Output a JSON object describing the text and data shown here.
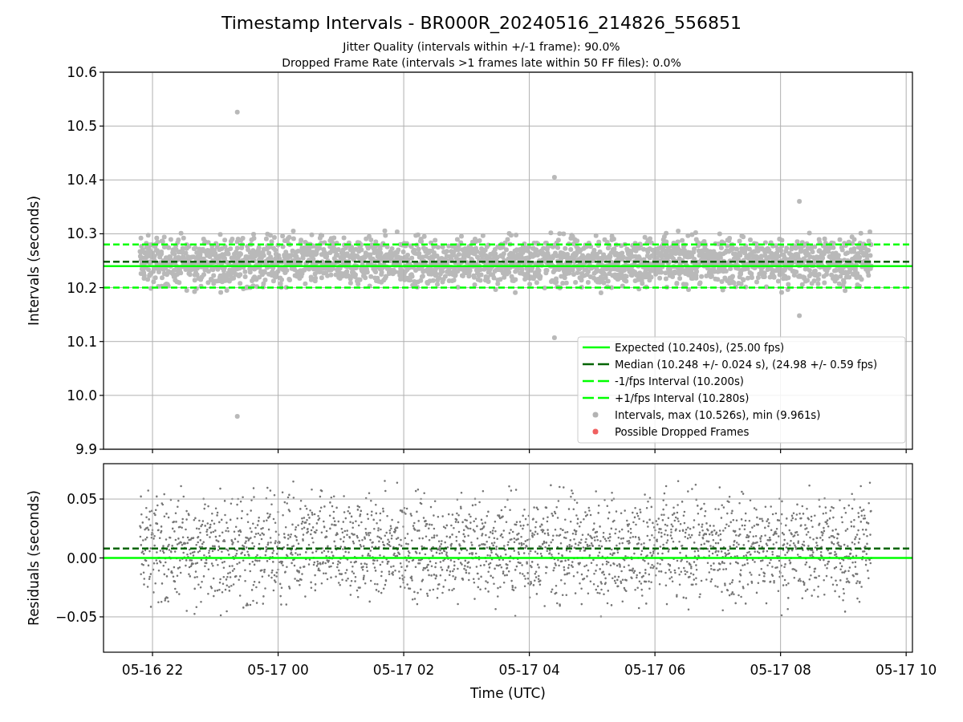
{
  "figure": {
    "title": "Timestamp Intervals - BR000R_20240516_214826_556851",
    "subtitles": [
      "Jitter Quality (intervals within +/-1 frame): 90.0%",
      "Dropped Frame Rate (intervals >1 frames late within 50 FF files): 0.0%"
    ]
  },
  "top_panel": {
    "chart_data": {
      "type": "scatter",
      "ylabel": "Intervals (seconds)",
      "ylim": [
        9.9,
        10.6
      ],
      "grid": true,
      "legend": true,
      "categories": [
        null,
        null,
        null,
        null,
        null,
        null,
        null
      ],
      "yticks": [
        {
          "value": 9.9,
          "label": "9.9"
        },
        {
          "value": 10.0,
          "label": "10.0"
        },
        {
          "value": 10.1,
          "label": "10.1"
        },
        {
          "value": 10.2,
          "label": "10.2"
        },
        {
          "value": 10.3,
          "label": "10.3"
        },
        {
          "value": 10.4,
          "label": "10.4"
        },
        {
          "value": 10.5,
          "label": "10.5"
        },
        {
          "value": 10.6,
          "label": "10.6"
        }
      ],
      "ref_lines": [
        {
          "axis": "y",
          "value": 10.24,
          "label": "Expected (10.240s), (25.00 fps)",
          "color": "#00ff00",
          "line_style": "solid"
        },
        {
          "axis": "y",
          "value": 10.248,
          "label": "Median (10.248 +/- 0.024 s), (24.98 +/- 0.59 fps)",
          "color": "#006400",
          "line_style": "dashed"
        },
        {
          "axis": "y",
          "value": 10.2,
          "label": "-1/fps Interval (10.200s)",
          "color": "#00ff00",
          "line_style": "dashed"
        },
        {
          "axis": "y",
          "value": 10.28,
          "label": "+1/fps Interval (10.280s)",
          "color": "#00ff00",
          "line_style": "dashed"
        }
      ]
    },
    "legend_markers": [
      {
        "color": "#b3b3b3",
        "label": "Intervals, max (10.526s), min (9.961s)"
      },
      {
        "color": "#f06060",
        "label": "Possible Dropped Frames"
      }
    ]
  },
  "bottom_panel": {
    "chart_data": {
      "type": "scatter",
      "xlabel": "Time (UTC)",
      "ylabel": "Residuals (seconds)",
      "ylim": [
        -0.08,
        0.08
      ],
      "grid": true,
      "categories": [
        "05-16 22",
        "05-17 00",
        "05-17 02",
        "05-17 04",
        "05-17 06",
        "05-17 08",
        "05-17 10"
      ],
      "yticks": [
        {
          "value": -0.05,
          "label": "−0.05"
        },
        {
          "value": 0,
          "label": "0.00"
        },
        {
          "value": 0.05,
          "label": "0.05"
        }
      ],
      "ref_lines": [
        {
          "axis": "y",
          "value": 0,
          "color": "#00ff00",
          "line_style": "solid"
        },
        {
          "axis": "y",
          "value": 0.008,
          "color": "#006400",
          "line_style": "dashed"
        }
      ]
    }
  }
}
